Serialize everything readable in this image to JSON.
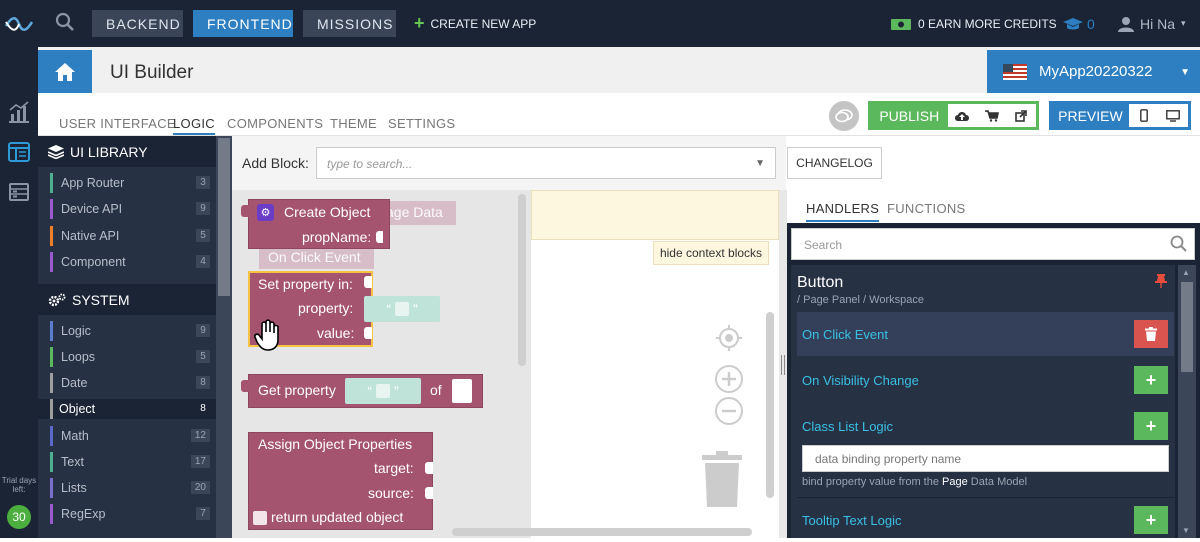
{
  "nav": {
    "backend": "BACKEND",
    "frontend": "FRONTEND",
    "missions": "MISSIONS",
    "create_new_app": "CREATE NEW APP",
    "earn_credits": "0 EARN MORE CREDITS",
    "cap_count": "0",
    "user": "Hi Na"
  },
  "trial": {
    "label": "Trial days left:",
    "days": "30"
  },
  "header": {
    "title": "UI Builder",
    "app_name": "MyApp20220322"
  },
  "tabs": [
    "USER INTERFACE",
    "LOGIC",
    "COMPONENTS",
    "THEME",
    "SETTINGS"
  ],
  "active_tab": "LOGIC",
  "publish": "PUBLISH",
  "preview": "PREVIEW",
  "sidebar": {
    "ui_library": "UI LIBRARY",
    "ui_items": [
      {
        "label": "App Router",
        "count": "3",
        "color": "#4caf8f"
      },
      {
        "label": "Device API",
        "count": "9",
        "color": "#9b59d0"
      },
      {
        "label": "Native API",
        "count": "5",
        "color": "#f07f2b"
      },
      {
        "label": "Component",
        "count": "4",
        "color": "#9b59d0"
      }
    ],
    "system": "SYSTEM",
    "system_items": [
      {
        "label": "Logic",
        "count": "9",
        "color": "#5b7ccc"
      },
      {
        "label": "Loops",
        "count": "5",
        "color": "#5cb85c"
      },
      {
        "label": "Date",
        "count": "8",
        "color": "#9e9e9e"
      },
      {
        "label": "Object",
        "count": "8",
        "color": "#9e9e9e"
      },
      {
        "label": "Math",
        "count": "12",
        "color": "#5b67c9"
      },
      {
        "label": "Text",
        "count": "17",
        "color": "#4caf8f"
      },
      {
        "label": "Lists",
        "count": "20",
        "color": "#7a6fcb"
      },
      {
        "label": "RegExp",
        "count": "7",
        "color": "#9b59d0"
      }
    ]
  },
  "editor": {
    "add_block_label": "Add Block:",
    "search_placeholder": "type to search...",
    "changelog": "CHANGELOG",
    "hide_context": "hide context blocks",
    "blocks": {
      "create_object": "Create Object",
      "prop_name": "propName:",
      "ghost_page_data": "age Data",
      "ghost_on_click": "On Click Event",
      "set_property_in": "Set property in:",
      "property": "property:",
      "value": "value:",
      "get_property": "Get property",
      "of": "of",
      "assign_object": "Assign Object Properties",
      "target": "target:",
      "source": "source:",
      "return_updated": "return updated object",
      "quote_open": "“",
      "quote_close": "”"
    }
  },
  "handlers": {
    "tab_handlers": "HANDLERS",
    "tab_functions": "FUNCTIONS",
    "search_placeholder": "Search",
    "component": "Button",
    "path": "/ Page Panel / Workspace",
    "rows": [
      "On Click Event",
      "On Visibility Change",
      "Class List Logic",
      "Tooltip Text Logic"
    ],
    "binding_placeholder": "data binding property name",
    "bind_hint_pre": "bind property value from the",
    "bind_hint_page": "Page",
    "bind_hint_post": "Data Model"
  }
}
